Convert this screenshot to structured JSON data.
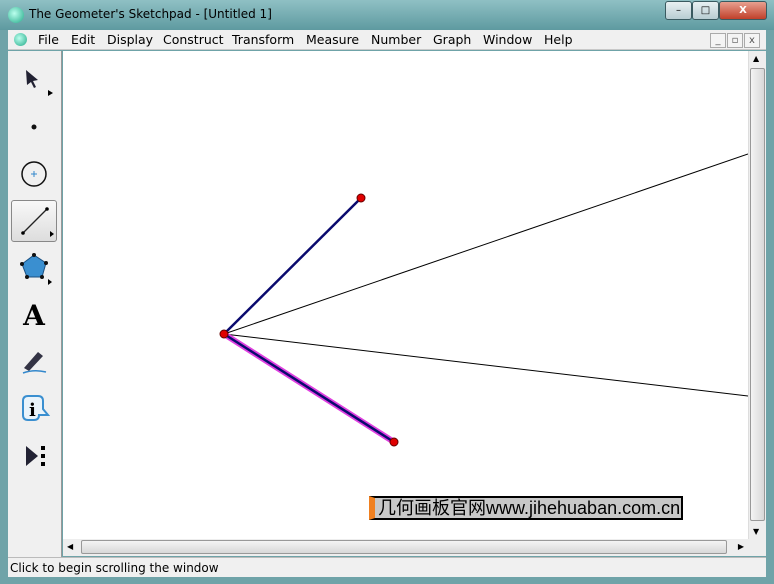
{
  "window": {
    "title": "The Geometer's Sketchpad - [Untitled 1]"
  },
  "menu": [
    "File",
    "Edit",
    "Display",
    "Construct",
    "Transform",
    "Measure",
    "Number",
    "Graph",
    "Window",
    "Help"
  ],
  "toolbox": [
    "arrow-tool",
    "point-tool",
    "compass-tool",
    "straightedge-tool",
    "polygon-tool",
    "text-tool",
    "marker-tool",
    "information-tool",
    "custom-tool"
  ],
  "text_tool_label": "A",
  "info_tool_label": "i",
  "watermark": "几何画板官网www.jihehuaban.com.cn",
  "status": "Click to begin scrolling the window",
  "colors": {
    "segment": "#0a0a6e",
    "point": "#e00000",
    "highlight": "#e040e0",
    "ray": "#000000"
  }
}
